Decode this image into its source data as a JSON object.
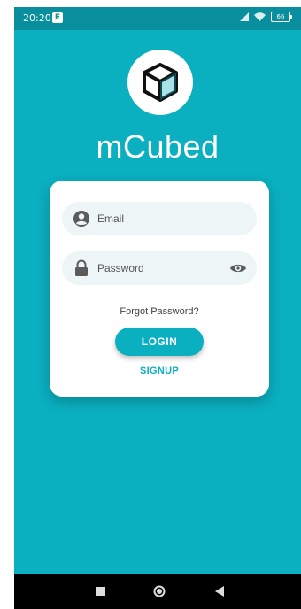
{
  "status_bar": {
    "time": "20:20",
    "badge": "E",
    "battery": "66"
  },
  "app": {
    "title": "mCubed",
    "logo_icon": "cube-icon"
  },
  "login_form": {
    "email_placeholder": "Email",
    "password_placeholder": "Password",
    "forgot_password": "Forgot Password?",
    "login_label": "LOGIN",
    "signup_label": "SIGNUP"
  },
  "icons": {
    "email": "account-circle-icon",
    "password": "lock-icon",
    "toggle_visibility": "eye-icon"
  },
  "nav_bar": {
    "recents": "square-icon",
    "home": "circle-icon",
    "back": "triangle-back-icon"
  },
  "colors": {
    "primary": "#0aafc0",
    "status_bar": "#088e9d",
    "card": "#ffffff",
    "field_bg": "#eef5f6"
  }
}
